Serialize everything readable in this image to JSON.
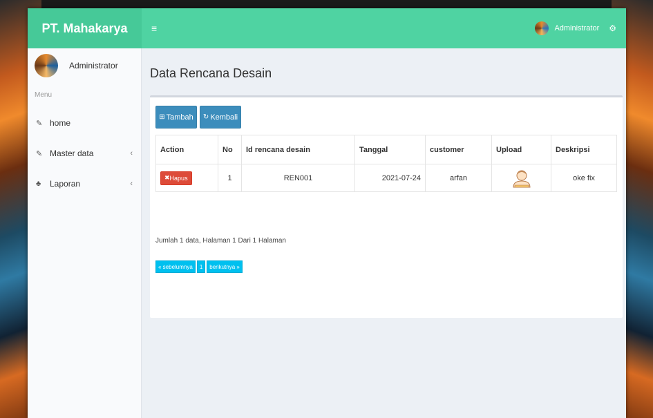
{
  "app": {
    "brand": "PT. Mahakarya",
    "menu_toggle": "≡"
  },
  "topbar": {
    "user": "Administrator",
    "settings_icon": "gears-icon"
  },
  "sidebar": {
    "user_name": "Administrator",
    "menu_header": "Menu",
    "items": [
      {
        "label": "home",
        "icon": "edit-icon",
        "chevron": ""
      },
      {
        "label": "Master data",
        "icon": "edit-icon",
        "chevron": "‹"
      },
      {
        "label": "Laporan",
        "icon": "sitemap-icon",
        "chevron": "‹"
      }
    ]
  },
  "page": {
    "title": "Data Rencana Desain",
    "buttons": {
      "tambah": "Tambah",
      "kembali": "Kembali"
    },
    "table": {
      "headers": [
        "Action",
        "No",
        "Id rencana desain",
        "Tanggal",
        "customer",
        "Upload",
        "Deskripsi"
      ],
      "rows": [
        {
          "action": "Hapus",
          "no": "1",
          "id": "REN001",
          "tanggal": "2021-07-24",
          "customer": "arfan",
          "upload": "user-image-icon",
          "deskripsi": "oke fix"
        }
      ]
    },
    "summary": "Jumlah 1 data, Halaman 1 Dari 1 Halaman",
    "pagination": {
      "prev": "« sebelumnya",
      "page": "1",
      "next": "berikutnya »"
    }
  },
  "colors": {
    "topbar": "#4fd3a2",
    "primary": "#3c8dbc",
    "danger": "#dd4b39",
    "info": "#00c0ef"
  }
}
